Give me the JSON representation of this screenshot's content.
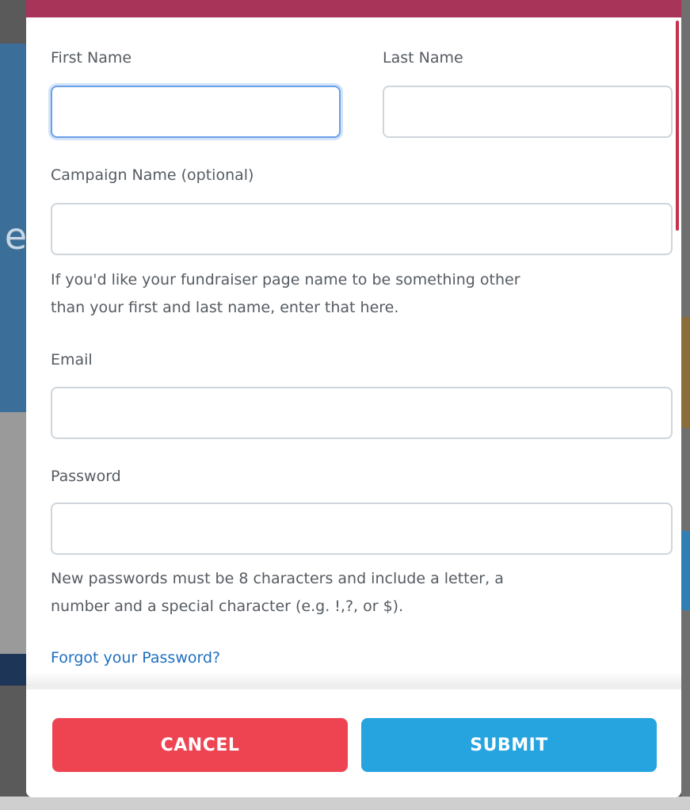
{
  "form": {
    "first_name": {
      "label": "First Name",
      "value": "",
      "placeholder": ""
    },
    "last_name": {
      "label": "Last Name",
      "value": "",
      "placeholder": ""
    },
    "campaign_name": {
      "label": "Campaign Name (optional)",
      "value": "",
      "placeholder": "",
      "help_line1": "If you'd like your fundraiser page name to be something other",
      "help_line2": "than your first and last name, enter that here."
    },
    "email": {
      "label": "Email",
      "value": "",
      "placeholder": ""
    },
    "password": {
      "label": "Password",
      "value": "",
      "placeholder": "",
      "help_line1": "New passwords must be 8 characters and include a letter, a",
      "help_line2": "number and a special character (e.g. !,?, or $)."
    },
    "forgot_password_link": "Forgot your Password?"
  },
  "footer": {
    "cancel_label": "CANCEL",
    "submit_label": "SUBMIT"
  },
  "colors": {
    "modal_topbar": "#a8345a",
    "cancel_button": "#ee4452",
    "submit_button": "#26a4df",
    "link": "#1f6fc0",
    "focus_ring": "#6aa0e8"
  }
}
